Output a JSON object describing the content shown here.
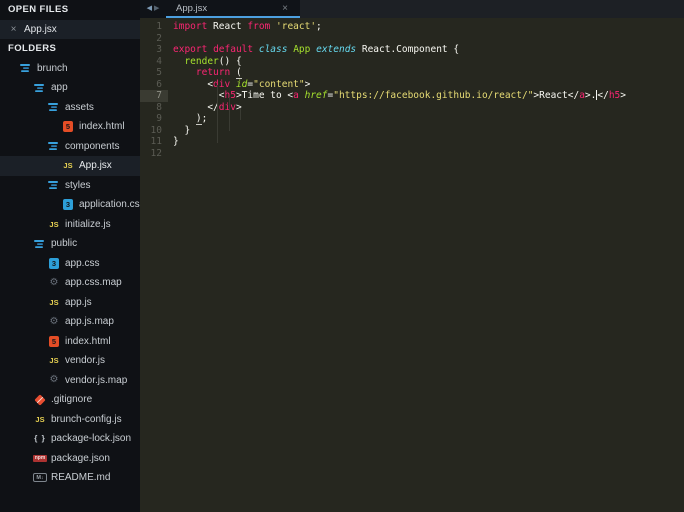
{
  "colors": {
    "sidebar_bg": "#0f1115",
    "editor_bg": "#26271f",
    "tabbar_bg": "#1d2025",
    "tab_bg": "#101318",
    "tab_underline": "#4c9fdf",
    "selected_row_bg": "#1b2027",
    "keyword": "#f92672",
    "string": "#e6db74",
    "function": "#a6e22e",
    "class_kw": "#66d9ef",
    "plain": "#f8f8f2",
    "line_number": "#5b5c54"
  },
  "sidebar": {
    "open_files_header": "OPEN FILES",
    "folders_header": "FOLDERS",
    "open_files": [
      {
        "name": "App.jsx",
        "close": "×"
      }
    ],
    "tree": [
      {
        "label": "brunch",
        "icon": "folder",
        "indent": 1
      },
      {
        "label": "app",
        "icon": "folder",
        "indent": 2
      },
      {
        "label": "assets",
        "icon": "folder",
        "indent": 3
      },
      {
        "label": "index.html",
        "icon": "html",
        "indent": 4
      },
      {
        "label": "components",
        "icon": "folder",
        "indent": 3
      },
      {
        "label": "App.jsx",
        "icon": "js",
        "indent": 4,
        "selected": true
      },
      {
        "label": "styles",
        "icon": "folder",
        "indent": 3
      },
      {
        "label": "application.css",
        "icon": "css",
        "indent": 4
      },
      {
        "label": "initialize.js",
        "icon": "js",
        "indent": 3
      },
      {
        "label": "public",
        "icon": "folder",
        "indent": 2
      },
      {
        "label": "app.css",
        "icon": "css",
        "indent": 3
      },
      {
        "label": "app.css.map",
        "icon": "map",
        "indent": 3
      },
      {
        "label": "app.js",
        "icon": "js",
        "indent": 3
      },
      {
        "label": "app.js.map",
        "icon": "map",
        "indent": 3
      },
      {
        "label": "index.html",
        "icon": "html",
        "indent": 3
      },
      {
        "label": "vendor.js",
        "icon": "js",
        "indent": 3
      },
      {
        "label": "vendor.js.map",
        "icon": "map",
        "indent": 3
      },
      {
        "label": ".gitignore",
        "icon": "git",
        "indent": 2
      },
      {
        "label": "brunch-config.js",
        "icon": "js",
        "indent": 2
      },
      {
        "label": "package-lock.json",
        "icon": "json",
        "indent": 2
      },
      {
        "label": "package.json",
        "icon": "npm",
        "indent": 2
      },
      {
        "label": "README.md",
        "icon": "md",
        "indent": 2
      }
    ]
  },
  "icon_glyphs": {
    "js": "JS",
    "html": "5",
    "css": "3",
    "map": "⚙",
    "json": "{ }",
    "npm": "npm",
    "md": "M↓"
  },
  "tabbar": {
    "prev_arrow": "◀",
    "next_arrow": "▶",
    "tabs": [
      {
        "title": "App.jsx",
        "close": "×",
        "active": true
      }
    ]
  },
  "editor": {
    "cursor_line": 7,
    "line_count": 12,
    "lines": [
      {
        "num": 1,
        "tokens": [
          [
            "k",
            "import"
          ],
          [
            "t",
            " React "
          ],
          [
            "k",
            "from"
          ],
          [
            "t",
            " "
          ],
          [
            "s",
            "'react'"
          ],
          [
            "t",
            ";"
          ]
        ]
      },
      {
        "num": 2,
        "tokens": []
      },
      {
        "num": 3,
        "tokens": [
          [
            "k",
            "export"
          ],
          [
            "t",
            " "
          ],
          [
            "k",
            "default"
          ],
          [
            "t",
            " "
          ],
          [
            "c",
            "class"
          ],
          [
            "t",
            " "
          ],
          [
            "f",
            "App"
          ],
          [
            "t",
            " "
          ],
          [
            "c",
            "extends"
          ],
          [
            "t",
            " React.Component {"
          ]
        ]
      },
      {
        "num": 4,
        "tokens": [
          [
            "t",
            "  "
          ],
          [
            "f",
            "render"
          ],
          [
            "t",
            "() {"
          ]
        ]
      },
      {
        "num": 5,
        "tokens": [
          [
            "t",
            "    "
          ],
          [
            "k",
            "return"
          ],
          [
            "t",
            " "
          ],
          [
            "b",
            "("
          ]
        ]
      },
      {
        "num": 6,
        "tokens": [
          [
            "t",
            "      <"
          ],
          [
            "k",
            "div"
          ],
          [
            "t",
            " "
          ],
          [
            "a",
            "id"
          ],
          [
            "t",
            "="
          ],
          [
            "s",
            "\"content\""
          ],
          [
            "t",
            ">"
          ]
        ]
      },
      {
        "num": 7,
        "tokens": [
          [
            "t",
            "        <"
          ],
          [
            "k",
            "h5"
          ],
          [
            "t",
            ">Time to <"
          ],
          [
            "k",
            "a"
          ],
          [
            "t",
            " "
          ],
          [
            "a",
            "href"
          ],
          [
            "t",
            "="
          ],
          [
            "s",
            "\"https://facebook.github.io/react/\""
          ],
          [
            "t",
            ">React</"
          ],
          [
            "k",
            "a"
          ],
          [
            "t",
            ">."
          ],
          [
            "caret",
            ""
          ],
          [
            "t",
            "</"
          ],
          [
            "k",
            "h5"
          ],
          [
            "t",
            ">"
          ]
        ]
      },
      {
        "num": 8,
        "tokens": [
          [
            "t",
            "      </"
          ],
          [
            "k",
            "div"
          ],
          [
            "t",
            ">"
          ]
        ]
      },
      {
        "num": 9,
        "tokens": [
          [
            "t",
            "    "
          ],
          [
            "b",
            ")"
          ],
          [
            "t",
            ";"
          ]
        ]
      },
      {
        "num": 10,
        "tokens": [
          [
            "t",
            "  }"
          ]
        ]
      },
      {
        "num": 11,
        "tokens": [
          [
            "t",
            "}"
          ]
        ]
      },
      {
        "num": 12,
        "tokens": []
      }
    ]
  }
}
